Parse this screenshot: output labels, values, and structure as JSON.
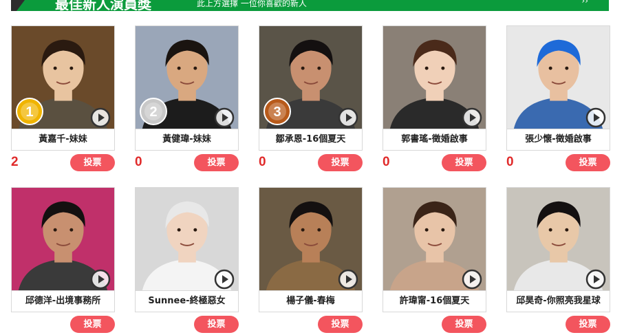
{
  "header": {
    "title": "最佳新人演員獎",
    "subtitle": "此上方選擇 一位你喜歡的新人",
    "nav": "››"
  },
  "vote_label": "投票",
  "candidates": [
    {
      "name": "黃嘉千-妹妹",
      "votes": "2",
      "rank": "1",
      "medal_color": "#f0b400",
      "bg": "#6a4a2a",
      "shirt": "#5a5040",
      "hair": "#2a1a10",
      "skin": "#e8c4a0"
    },
    {
      "name": "黃健瑋-妹妹",
      "votes": "0",
      "rank": "2",
      "medal_color": "#c8c8c8",
      "bg": "#9aa6b8",
      "shirt": "#1c1c1c",
      "hair": "#1a1410",
      "skin": "#d9a880"
    },
    {
      "name": "鄒承恩-16個夏天",
      "votes": "0",
      "rank": "3",
      "medal_color": "#b85a1a",
      "bg": "#5a5448",
      "shirt": "#3a3a3a",
      "hair": "#141010",
      "skin": "#c89070"
    },
    {
      "name": "郭書瑤-徵婚啟事",
      "votes": "0",
      "rank": "",
      "medal_color": "",
      "bg": "#8a8076",
      "shirt": "#2a2a2a",
      "hair": "#4a2a1a",
      "skin": "#f0d0b8"
    },
    {
      "name": "張少懷-徵婚啟事",
      "votes": "0",
      "rank": "",
      "medal_color": "",
      "bg": "#e8e8e8",
      "shirt": "#3a6ab0",
      "hair": "#1e6ad8",
      "skin": "#e8c0a0"
    },
    {
      "name": "邱德洋-出境事務所",
      "votes": "",
      "rank": "",
      "medal_color": "",
      "bg": "#c0306a",
      "shirt": "#3a3a3a",
      "hair": "#141010",
      "skin": "#c89070"
    },
    {
      "name": "Sunnee-終極惡女",
      "votes": "",
      "rank": "",
      "medal_color": "",
      "bg": "#d8d8d8",
      "shirt": "#f4f4f4",
      "hair": "#e8e8e8",
      "skin": "#f0d4c0"
    },
    {
      "name": "楊子儀-春梅",
      "votes": "",
      "rank": "",
      "medal_color": "",
      "bg": "#6a5a44",
      "shirt": "#8a6a44",
      "hair": "#141010",
      "skin": "#b88058"
    },
    {
      "name": "許瑋甯-16個夏天",
      "votes": "",
      "rank": "",
      "medal_color": "",
      "bg": "#b0a090",
      "shirt": "#c8a48a",
      "hair": "#3a2418",
      "skin": "#e8c4a8"
    },
    {
      "name": "邱昊奇-你照亮我星球",
      "votes": "",
      "rank": "",
      "medal_color": "",
      "bg": "#c8c4bc",
      "shirt": "#e8e8e8",
      "hair": "#141010",
      "skin": "#e8c8a8"
    }
  ]
}
